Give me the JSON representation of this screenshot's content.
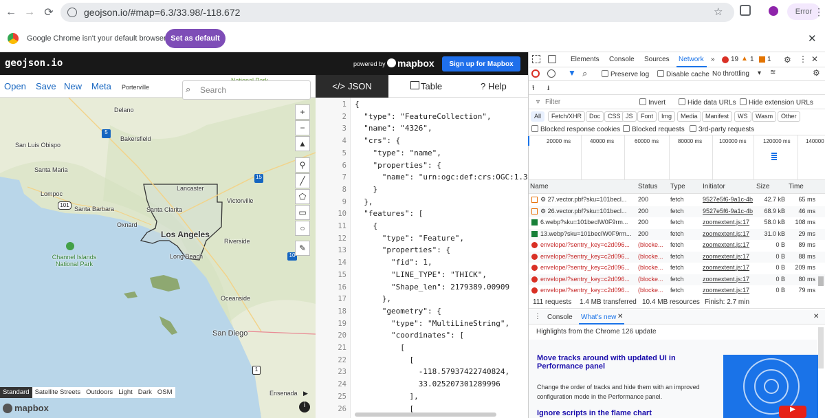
{
  "browser": {
    "url": "geojson.io/#map=6.3/33.98/-118.672",
    "profile_label": "Error"
  },
  "infobar": {
    "message": "Google Chrome isn't your default browser",
    "button": "Set as default"
  },
  "header": {
    "logo": "geojson.io",
    "powered_by": "powered by",
    "mapbox": "mapbox",
    "signup": "Sign up for Mapbox"
  },
  "menu": {
    "open": "Open",
    "save": "Save",
    "new": "New",
    "meta": "Meta",
    "search_placeholder": "Search"
  },
  "map": {
    "labels": [
      "Porterville",
      "Delano",
      "Bakersfield",
      "San Luis Obispo",
      "Santa Maria",
      "Lompoc",
      "Lancaster",
      "Santa Barbara",
      "Santa Clarita",
      "Victorville",
      "Oxnard",
      "Los Angeles",
      "Riverside",
      "Long Beach",
      "Channel Islands National Park",
      "Oceanside",
      "San Diego",
      "Ensenada",
      "National Park"
    ],
    "styles": [
      "Standard",
      "Satellite Streets",
      "Outdoors",
      "Light",
      "Dark",
      "OSM"
    ],
    "attribution": "mapbox",
    "route_shields": [
      "5",
      "101",
      "15",
      "10",
      "1"
    ]
  },
  "editor": {
    "tabs": {
      "json": "JSON",
      "table": "Table",
      "help": "Help"
    },
    "lines": [
      "{",
      "  \"type\": \"FeatureCollection\",",
      "  \"name\": \"4326\",",
      "  \"crs\": {",
      "    \"type\": \"name\",",
      "    \"properties\": {",
      "      \"name\": \"urn:ogc:def:crs:OGC:1.3:",
      "    }",
      "  },",
      "  \"features\": [",
      "    {",
      "      \"type\": \"Feature\",",
      "      \"properties\": {",
      "        \"fid\": 1,",
      "        \"LINE_TYPE\": \"THICK\",",
      "        \"Shape_len\": 2179389.00909",
      "      },",
      "      \"geometry\": {",
      "        \"type\": \"MultiLineString\",",
      "        \"coordinates\": [",
      "          [",
      "            [",
      "              -118.57937422740824,",
      "              33.025207301289996",
      "            ],",
      "            ["
    ],
    "line_numbers": [
      "1",
      "2",
      "3",
      "4",
      "5",
      "6",
      "7",
      "8",
      "9",
      "10",
      "11",
      "12",
      "13",
      "14",
      "15",
      "16",
      "17",
      "18",
      "19",
      "20",
      "21",
      "22",
      "23",
      "24",
      "25",
      "26"
    ]
  },
  "devtools": {
    "tabs": [
      "Elements",
      "Console",
      "Sources",
      "Network"
    ],
    "errors": "19",
    "warnings": "1",
    "issues": "1",
    "preserve_log": "Preserve log",
    "disable_cache": "Disable cache",
    "throttling": "No throttling",
    "filter_placeholder": "Filter",
    "invert": "Invert",
    "hide_data_urls": "Hide data URLs",
    "hide_ext_urls": "Hide extension URLs",
    "type_filters": [
      "All",
      "Fetch/XHR",
      "Doc",
      "CSS",
      "JS",
      "Font",
      "Img",
      "Media",
      "Manifest",
      "WS",
      "Wasm",
      "Other"
    ],
    "blocked_cookies": "Blocked response cookies",
    "blocked_requests": "Blocked requests",
    "third_party": "3rd-party requests",
    "timeline": [
      "20000 ms",
      "40000 ms",
      "60000 ms",
      "80000 ms",
      "100000 ms",
      "120000 ms",
      "140000"
    ],
    "columns": [
      "Name",
      "Status",
      "Type",
      "Initiator",
      "Size",
      "Time"
    ],
    "rows": [
      {
        "name": "⚙ 27.vector.pbf?sku=101becl...",
        "status": "200",
        "type": "fetch",
        "initiator": "9527e5f6-9a1c-4b",
        "size": "42.7 kB",
        "time": "65 ms",
        "kind": "pbf"
      },
      {
        "name": "⚙ 26.vector.pbf?sku=101becl...",
        "status": "200",
        "type": "fetch",
        "initiator": "9527e5f6-9a1c-4b",
        "size": "68.9 kB",
        "time": "46 ms",
        "kind": "pbf"
      },
      {
        "name": "6.webp?sku=101becIW0F9rm...",
        "status": "200",
        "type": "fetch",
        "initiator": "zoomextent.js:17",
        "size": "58.0 kB",
        "time": "108 ms",
        "kind": "img"
      },
      {
        "name": "13.webp?sku=101becIW0F9rm...",
        "status": "200",
        "type": "fetch",
        "initiator": "zoomextent.js:17",
        "size": "31.0 kB",
        "time": "29 ms",
        "kind": "img"
      },
      {
        "name": "envelope/?sentry_key=c2d096...",
        "status": "(blocke...",
        "type": "fetch",
        "initiator": "zoomextent.js:17",
        "size": "0 B",
        "time": "89 ms",
        "kind": "err"
      },
      {
        "name": "envelope/?sentry_key=c2d096...",
        "status": "(blocke...",
        "type": "fetch",
        "initiator": "zoomextent.js:17",
        "size": "0 B",
        "time": "88 ms",
        "kind": "err"
      },
      {
        "name": "envelope/?sentry_key=c2d096...",
        "status": "(blocke...",
        "type": "fetch",
        "initiator": "zoomextent.js:17",
        "size": "0 B",
        "time": "209 ms",
        "kind": "err"
      },
      {
        "name": "envelope/?sentry_key=c2d096...",
        "status": "(blocke...",
        "type": "fetch",
        "initiator": "zoomextent.js:17",
        "size": "0 B",
        "time": "80 ms",
        "kind": "err"
      },
      {
        "name": "envelope/?sentry_key=c2d096...",
        "status": "(blocke...",
        "type": "fetch",
        "initiator": "zoomextent.js:17",
        "size": "0 B",
        "time": "79 ms",
        "kind": "err"
      }
    ],
    "summary": {
      "requests": "111 requests",
      "transferred": "1.4 MB transferred",
      "resources": "10.4 MB resources",
      "finish": "Finish: 2.7 min"
    },
    "drawer_tabs": {
      "console": "Console",
      "whats_new": "What's new"
    },
    "whats_new": {
      "highlights": "Highlights from the Chrome 126 update",
      "h1": "Move tracks around with updated UI in Performance panel",
      "p1": "Change the order of tracks and hide them with an improved configuration mode in the Performance panel.",
      "h2": "Ignore scripts in the flame chart"
    }
  }
}
